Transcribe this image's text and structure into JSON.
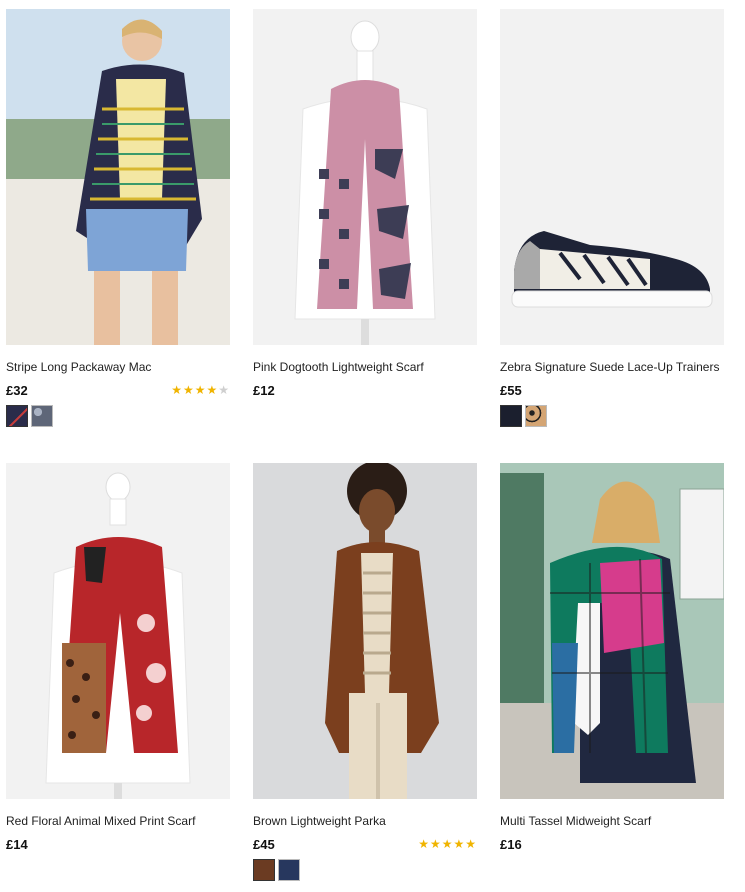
{
  "products": [
    {
      "id_label": "stripe-long-packaway-mac",
      "title": "Stripe Long Packaway Mac",
      "price": "£32",
      "rating": 4.5,
      "rating_stars": "★★★★★",
      "swatches": [
        "#2a2c4a",
        "#7f8794"
      ]
    },
    {
      "id_label": "pink-dogtooth-lightweight-scarf",
      "title": "Pink Dogtooth Lightweight Scarf",
      "price": "£12",
      "rating": null,
      "swatches": []
    },
    {
      "id_label": "zebra-signature-suede-lace-up-trainers",
      "title": "Zebra Signature Suede Lace-Up Trainers",
      "price": "£55",
      "rating": null,
      "swatches": [
        "#1b1f2e",
        "#c08a55"
      ]
    },
    {
      "id_label": "red-floral-animal-mixed-print-scarf",
      "title": "Red Floral Animal Mixed Print Scarf",
      "price": "£14",
      "rating": null,
      "swatches": []
    },
    {
      "id_label": "brown-lightweight-parka",
      "title": "Brown Lightweight Parka",
      "price": "£45",
      "rating": 5,
      "rating_stars": "★★★★★",
      "swatches": [
        "#6b3b22",
        "#27375e"
      ]
    },
    {
      "id_label": "multi-tassel-midweight-scarf",
      "title": "Multi Tassel Midweight Scarf",
      "price": "£16",
      "rating": null,
      "swatches": []
    }
  ],
  "colors": {
    "star": "#f0b400",
    "star_empty": "#cfcfcf",
    "image_bg": "#f2f2f2"
  }
}
